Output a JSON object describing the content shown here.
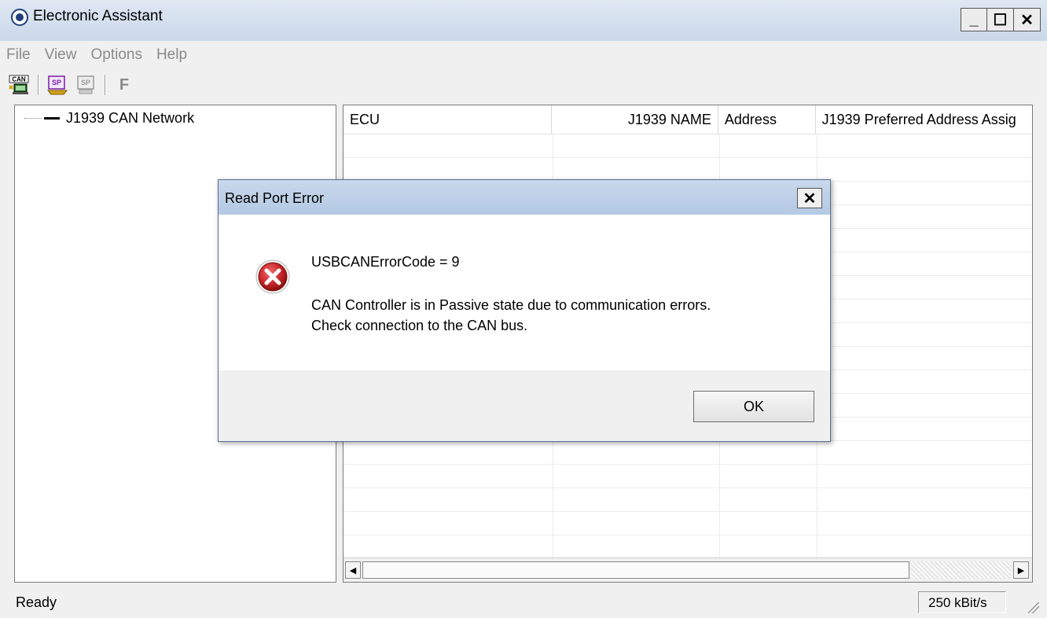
{
  "window": {
    "title": "Electronic Assistant",
    "minimize_label": "_",
    "maximize_label": "☐",
    "close_label": "✕"
  },
  "menu": {
    "items": [
      "File",
      "View",
      "Options",
      "Help"
    ]
  },
  "toolbar": {
    "buttons": [
      "can-network-icon",
      "spn-edit-icon",
      "spn-disabled-icon"
    ],
    "f_label": "F",
    "can_label": "CAN",
    "sp_label": "SP"
  },
  "tree": {
    "root_label": "J1939 CAN Network"
  },
  "list": {
    "columns": [
      "ECU",
      "J1939 NAME",
      "Address",
      "J1939 Preferred Address Assig"
    ]
  },
  "status": {
    "text": "Ready",
    "bitrate": "250 kBit/s"
  },
  "dialog": {
    "title": "Read Port Error",
    "close_label": "✕",
    "code_text": "USBCANErrorCode = 9",
    "message_line1": "CAN Controller is in Passive state due to communication errors.",
    "message_line2": "Check connection to the CAN bus.",
    "ok_label": "OK"
  },
  "colors": {
    "title_bar": "#cad8ea",
    "dialog_title": "#b4c9e3",
    "error_red": "#c8262b"
  }
}
